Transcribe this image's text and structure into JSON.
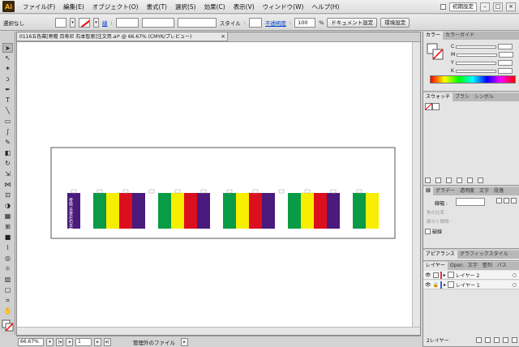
{
  "app": {
    "logo": "Ai"
  },
  "menu": [
    "ファイル(F)",
    "編集(E)",
    "オブジェクト(O)",
    "書式(T)",
    "選択(S)",
    "効果(C)",
    "表示(V)",
    "ウィンドウ(W)",
    "ヘルプ(H)"
  ],
  "menubar_right": {
    "workspace": "初期設定"
  },
  "control": {
    "selection": "選択なし",
    "stroke_label": "線",
    "style_label": "スタイル",
    "opacity_label": "不透明度",
    "opacity_value": "100",
    "opacity_unit": "%",
    "doc_setup_button": "ドキュメント設定",
    "prefs_button": "環境設定"
  },
  "document": {
    "tab_title": "0116五色幕[寄贈 百寿尼 石本智恵]注文用.ai* @ 66.67% (CMYK/プレビュー)",
    "banner_text": "寄贈 百寿尼石本智恵",
    "stripe_colors": [
      "#4b1a7d",
      "#ffffff",
      "#0a9b47",
      "#f8ee00",
      "#dc0f1e",
      "#4b1a7d",
      "#ffffff",
      "#0a9b47",
      "#f8ee00",
      "#dc0f1e",
      "#4b1a7d",
      "#ffffff",
      "#0a9b47",
      "#f8ee00",
      "#dc0f1e",
      "#4b1a7d",
      "#ffffff",
      "#0a9b47",
      "#f8ee00",
      "#dc0f1e",
      "#4b1a7d",
      "#ffffff",
      "#0a9b47",
      "#f8ee00"
    ]
  },
  "status": {
    "zoom": "66.67%",
    "page": "1",
    "info": "管理外のファイル"
  },
  "panels": {
    "color_tabs": [
      "カラー",
      "カラーガイド"
    ],
    "channels": [
      "C",
      "M",
      "Y",
      "K"
    ],
    "swatch_tabs": [
      "スウォッチ",
      "ブラシ",
      "シンボル"
    ],
    "stroke_tabs": [
      "線",
      "グラデー",
      "透明度",
      "文字",
      "段落"
    ],
    "stroke_weight_label": "線幅 :",
    "stroke_extra_labels": [
      "角の比率 :",
      "線分と間隔 :"
    ],
    "dash_label": "破線",
    "appearance_tabs": [
      "アピアランス",
      "グラフィックスタイル"
    ],
    "layer_tabs": [
      "レイヤー",
      "Open",
      "文字",
      "整列",
      "パス"
    ],
    "layers": [
      {
        "name": "レイヤー 2",
        "color": "#e53030"
      },
      {
        "name": "レイヤー 1",
        "color": "#3a5bd8"
      }
    ],
    "layer_count": "2レイヤー"
  }
}
